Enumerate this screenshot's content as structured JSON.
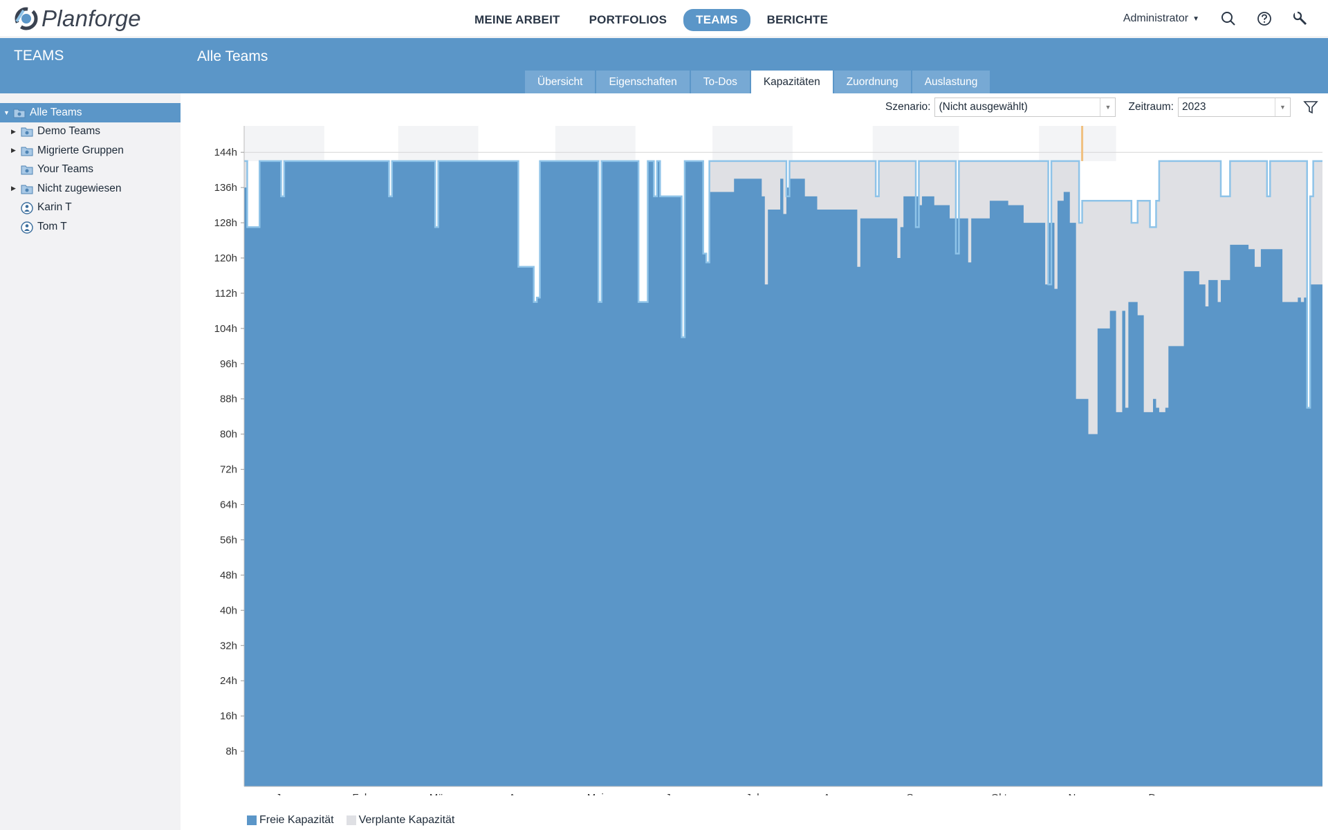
{
  "app": {
    "name": "Planforge"
  },
  "nav": {
    "items": [
      "MEINE ARBEIT",
      "PORTFOLIOS",
      "TEAMS",
      "BERICHTE"
    ],
    "active": 2
  },
  "user": {
    "label": "Administrator"
  },
  "icons": [
    "search-icon",
    "help-icon",
    "wrench-icon"
  ],
  "sidebar": {
    "title": "TEAMS",
    "items": [
      {
        "label": "Alle Teams",
        "icon": "team-folder-icon",
        "expandable": true,
        "expanded": true,
        "selected": true
      },
      {
        "label": "Demo Teams",
        "icon": "team-folder-icon",
        "expandable": true
      },
      {
        "label": "Migrierte Gruppen",
        "icon": "team-folder-icon",
        "expandable": true
      },
      {
        "label": "Your Teams",
        "icon": "team-folder-icon",
        "expandable": false
      },
      {
        "label": "Nicht zugewiesen",
        "icon": "team-folder-icon",
        "expandable": true
      },
      {
        "label": "Karin T",
        "icon": "person-icon",
        "expandable": false
      },
      {
        "label": "Tom T",
        "icon": "person-icon",
        "expandable": false
      }
    ]
  },
  "content": {
    "title": "Alle Teams",
    "tabs": [
      "Übersicht",
      "Eigenschaften",
      "To-Dos",
      "Kapazitäten",
      "Zuordnung",
      "Auslastung"
    ],
    "active_tab": 3
  },
  "filters": {
    "scenario_label": "Szenario:",
    "scenario_value": "(Nicht ausgewählt)",
    "period_label": "Zeitraum:",
    "period_value": "2023"
  },
  "colors": {
    "brand": "#5b96c8",
    "free": "#5b96c8",
    "planned": "#dfe0e4",
    "outline": "#8ec3e8",
    "today": "#f0c080"
  },
  "chart_data": {
    "type": "area",
    "title": "",
    "xlabel": "",
    "ylabel": "",
    "ylim": [
      0,
      150
    ],
    "y_ticks": [
      "8h",
      "16h",
      "24h",
      "32h",
      "40h",
      "48h",
      "56h",
      "64h",
      "72h",
      "80h",
      "88h",
      "96h",
      "104h",
      "112h",
      "120h",
      "128h",
      "136h",
      "144h"
    ],
    "x_months": [
      "Jan",
      "Feb",
      "Mär",
      "Apr",
      "Mai",
      "Jun",
      "Jul",
      "Aug",
      "Sep",
      "Okt",
      "Nov",
      "Dez"
    ],
    "today_day": 272,
    "series": [
      {
        "name": "Freie Kapazität",
        "segments": [
          [
            0,
            1,
            136
          ],
          [
            1,
            5,
            127
          ],
          [
            5,
            12,
            142
          ],
          [
            12,
            13,
            134
          ],
          [
            13,
            47,
            142
          ],
          [
            47,
            48,
            134
          ],
          [
            48,
            62,
            142
          ],
          [
            62,
            63,
            127
          ],
          [
            63,
            89,
            142
          ],
          [
            89,
            94,
            118
          ],
          [
            94,
            95,
            110
          ],
          [
            95,
            96,
            111
          ],
          [
            96,
            115,
            142
          ],
          [
            115,
            116,
            110
          ],
          [
            116,
            128,
            142
          ],
          [
            128,
            131,
            110
          ],
          [
            131,
            133,
            142
          ],
          [
            133,
            134,
            134
          ],
          [
            134,
            135,
            142
          ],
          [
            135,
            136,
            134
          ],
          [
            136,
            142,
            134
          ],
          [
            142,
            143,
            102
          ],
          [
            143,
            149,
            142
          ],
          [
            149,
            150,
            121
          ],
          [
            150,
            151,
            119
          ],
          [
            151,
            152,
            135
          ],
          [
            152,
            159,
            135
          ],
          [
            159,
            168,
            138
          ],
          [
            168,
            169,
            134
          ],
          [
            169,
            170,
            114
          ],
          [
            170,
            174,
            131
          ],
          [
            174,
            175,
            138
          ],
          [
            175,
            176,
            130
          ],
          [
            176,
            177,
            136
          ],
          [
            177,
            182,
            138
          ],
          [
            182,
            186,
            134
          ],
          [
            186,
            192,
            131
          ],
          [
            192,
            193,
            131
          ],
          [
            193,
            199,
            131
          ],
          [
            199,
            200,
            118
          ],
          [
            200,
            201,
            129
          ],
          [
            201,
            212,
            129
          ],
          [
            212,
            213,
            120
          ],
          [
            213,
            214,
            127
          ],
          [
            214,
            219,
            134
          ],
          [
            219,
            220,
            132
          ],
          [
            220,
            224,
            134
          ],
          [
            224,
            229,
            132
          ],
          [
            229,
            235,
            129
          ],
          [
            235,
            236,
            119
          ],
          [
            236,
            242,
            129
          ],
          [
            242,
            248,
            133
          ],
          [
            248,
            253,
            132
          ],
          [
            253,
            260,
            128
          ],
          [
            260,
            261,
            114
          ],
          [
            261,
            263,
            128
          ],
          [
            263,
            264,
            113
          ],
          [
            264,
            266,
            133
          ],
          [
            266,
            268,
            135
          ],
          [
            268,
            270,
            128
          ],
          [
            270,
            272,
            88
          ],
          [
            272,
            274,
            88
          ],
          [
            274,
            276,
            80
          ],
          [
            276,
            277,
            80
          ],
          [
            277,
            278,
            104
          ],
          [
            278,
            281,
            104
          ],
          [
            281,
            283,
            108
          ],
          [
            283,
            285,
            85
          ],
          [
            285,
            286,
            108
          ],
          [
            286,
            287,
            86
          ],
          [
            287,
            288,
            110
          ],
          [
            288,
            290,
            110
          ],
          [
            290,
            292,
            107
          ],
          [
            292,
            295,
            85
          ],
          [
            295,
            296,
            88
          ],
          [
            296,
            297,
            86
          ],
          [
            297,
            299,
            85
          ],
          [
            299,
            300,
            86
          ],
          [
            300,
            303,
            100
          ],
          [
            303,
            305,
            100
          ],
          [
            305,
            307,
            117
          ],
          [
            307,
            310,
            117
          ],
          [
            310,
            312,
            114
          ],
          [
            312,
            313,
            109
          ],
          [
            313,
            316,
            115
          ],
          [
            316,
            317,
            110
          ],
          [
            317,
            320,
            115
          ],
          [
            320,
            322,
            123
          ],
          [
            322,
            326,
            123
          ],
          [
            326,
            328,
            122
          ],
          [
            328,
            330,
            118
          ],
          [
            330,
            331,
            122
          ],
          [
            331,
            337,
            122
          ],
          [
            337,
            342,
            110
          ],
          [
            342,
            343,
            111
          ],
          [
            343,
            344,
            110
          ],
          [
            344,
            345,
            111
          ],
          [
            345,
            346,
            86
          ],
          [
            346,
            348,
            114
          ],
          [
            348,
            350,
            114
          ]
        ]
      },
      {
        "name": "Verplante Kapazität",
        "segments": [
          [
            0,
            1,
            142
          ],
          [
            1,
            5,
            127
          ],
          [
            5,
            12,
            142
          ],
          [
            12,
            13,
            134
          ],
          [
            13,
            47,
            142
          ],
          [
            47,
            48,
            134
          ],
          [
            48,
            62,
            142
          ],
          [
            62,
            63,
            127
          ],
          [
            63,
            89,
            142
          ],
          [
            89,
            94,
            118
          ],
          [
            94,
            95,
            110
          ],
          [
            95,
            96,
            111
          ],
          [
            96,
            115,
            142
          ],
          [
            115,
            116,
            110
          ],
          [
            116,
            128,
            142
          ],
          [
            128,
            131,
            110
          ],
          [
            131,
            133,
            142
          ],
          [
            133,
            134,
            134
          ],
          [
            134,
            135,
            142
          ],
          [
            135,
            136,
            134
          ],
          [
            136,
            142,
            134
          ],
          [
            142,
            143,
            102
          ],
          [
            143,
            149,
            142
          ],
          [
            149,
            150,
            121
          ],
          [
            150,
            151,
            119
          ],
          [
            151,
            152,
            142
          ],
          [
            152,
            176,
            142
          ],
          [
            176,
            177,
            134
          ],
          [
            177,
            205,
            142
          ],
          [
            205,
            206,
            134
          ],
          [
            206,
            218,
            142
          ],
          [
            218,
            219,
            127
          ],
          [
            219,
            231,
            142
          ],
          [
            231,
            232,
            121
          ],
          [
            232,
            261,
            142
          ],
          [
            261,
            262,
            114
          ],
          [
            262,
            264,
            142
          ],
          [
            264,
            266,
            142
          ],
          [
            266,
            271,
            142
          ],
          [
            271,
            272,
            128
          ],
          [
            272,
            277,
            133
          ],
          [
            277,
            280,
            133
          ],
          [
            280,
            288,
            133
          ],
          [
            288,
            290,
            128
          ],
          [
            290,
            292,
            133
          ],
          [
            292,
            294,
            133
          ],
          [
            294,
            295,
            127
          ],
          [
            295,
            296,
            127
          ],
          [
            296,
            297,
            133
          ],
          [
            297,
            303,
            142
          ],
          [
            303,
            305,
            142
          ],
          [
            305,
            317,
            142
          ],
          [
            317,
            320,
            134
          ],
          [
            320,
            332,
            142
          ],
          [
            332,
            333,
            134
          ],
          [
            333,
            342,
            142
          ],
          [
            342,
            345,
            142
          ],
          [
            345,
            346,
            86
          ],
          [
            346,
            347,
            134
          ],
          [
            347,
            350,
            142
          ]
        ]
      }
    ],
    "legend": [
      "Freie Kapazität",
      "Verplante Kapazität"
    ],
    "legend_position": "bottom-left",
    "grid": false
  }
}
